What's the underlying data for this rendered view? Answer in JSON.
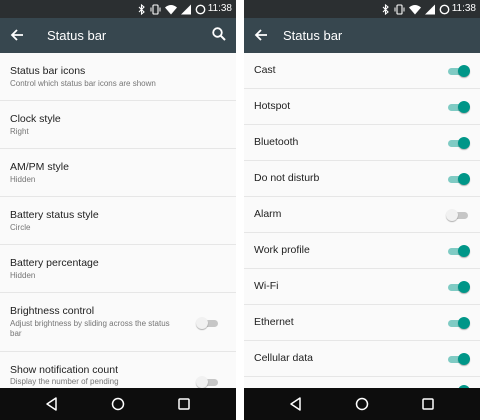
{
  "colors": {
    "status_bar": "#2b2f31",
    "toolbar": "#37474f",
    "accent": "#009688",
    "accent_track": "#80cbc4",
    "background": "#fafafa",
    "nav_bar": "#0d0d0d"
  },
  "status_bar": {
    "time": "11:38",
    "icons": [
      "bluetooth-icon",
      "vibrate-icon",
      "wifi-icon",
      "signal-icon",
      "battery-icon"
    ]
  },
  "left": {
    "toolbar": {
      "title": "Status bar",
      "back_icon": "arrow-back-icon",
      "search_icon": "search-icon"
    },
    "preferences": [
      {
        "title": "Status bar icons",
        "summary": "Control which status bar icons are shown"
      },
      {
        "title": "Clock style",
        "summary": "Right"
      },
      {
        "title": "AM/PM style",
        "summary": "Hidden"
      },
      {
        "title": "Battery status style",
        "summary": "Circle"
      },
      {
        "title": "Battery percentage",
        "summary": "Hidden"
      },
      {
        "title": "Brightness control",
        "summary": "Adjust brightness by sliding across the status bar",
        "switch_on": false
      },
      {
        "title": "Show notification count",
        "summary": "Display the number of pending",
        "switch_on": false
      }
    ]
  },
  "right": {
    "toolbar": {
      "title": "Status bar",
      "back_icon": "arrow-back-icon"
    },
    "toggles": [
      {
        "label": "Cast",
        "on": true
      },
      {
        "label": "Hotspot",
        "on": true
      },
      {
        "label": "Bluetooth",
        "on": true
      },
      {
        "label": "Do not disturb",
        "on": true
      },
      {
        "label": "Alarm",
        "on": false
      },
      {
        "label": "Work profile",
        "on": true
      },
      {
        "label": "Wi-Fi",
        "on": true
      },
      {
        "label": "Ethernet",
        "on": true
      },
      {
        "label": "Cellular data",
        "on": true
      }
    ]
  },
  "nav_bar": {
    "icons": [
      "back-nav-icon",
      "home-nav-icon",
      "recents-nav-icon"
    ]
  }
}
